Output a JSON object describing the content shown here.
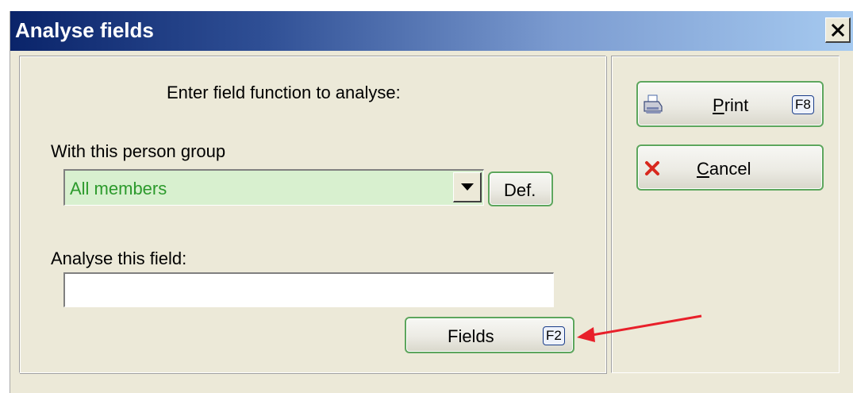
{
  "window": {
    "title": "Analyse fields",
    "close_label": "X"
  },
  "main": {
    "heading": "Enter field function to analyse:",
    "group_label": "With this person group",
    "group_select": {
      "value": "All members"
    },
    "def_button": "Def.",
    "field_label": "Analyse this field:",
    "field_input": {
      "value": "",
      "placeholder": ""
    },
    "fields_button": {
      "label": "Fields",
      "shortcut": "F2"
    }
  },
  "side": {
    "print_button": {
      "mnemonic": "P",
      "rest": "rint",
      "shortcut": "F8",
      "icon": "printer-icon"
    },
    "cancel_button": {
      "mnemonic": "C",
      "rest": "ancel",
      "icon": "red-x-icon"
    }
  },
  "colors": {
    "title_gradient_start": "#0a246a",
    "title_gradient_end": "#a6caf0",
    "button_border": "#5da65d",
    "combo_bg": "#d8f0cf",
    "combo_text": "#2c9a2c",
    "annotation_arrow": "#e8202a"
  }
}
